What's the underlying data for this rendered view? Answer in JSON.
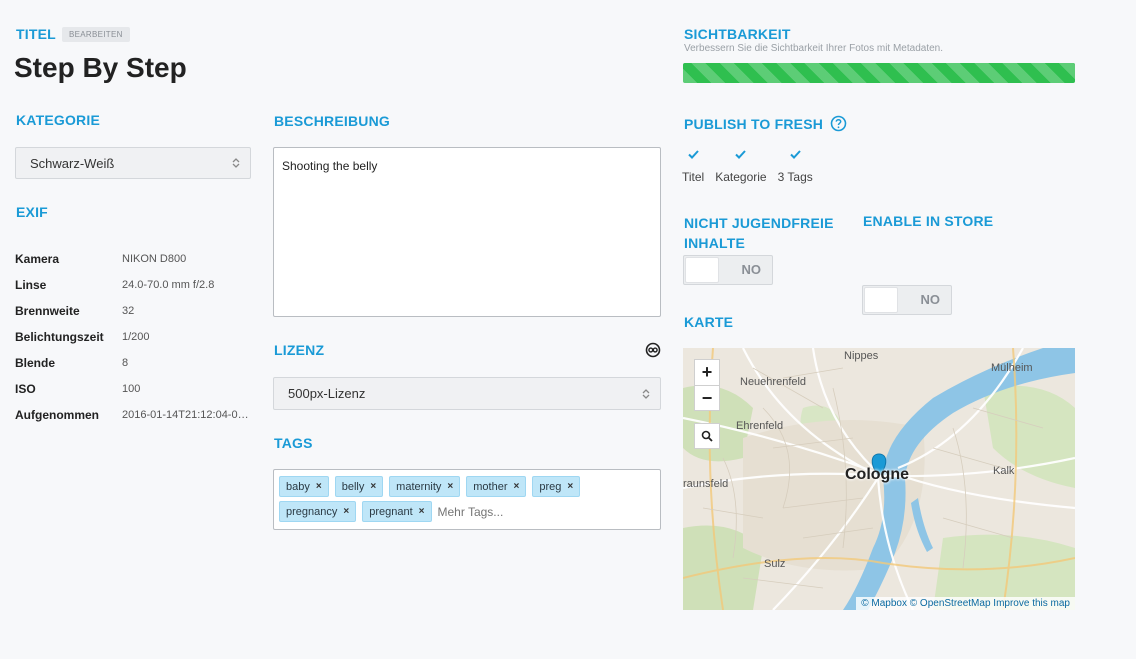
{
  "title": {
    "section_label": "TITEL",
    "edit_badge": "BEARBEITEN",
    "value": "Step By Step"
  },
  "category": {
    "section_label": "KATEGORIE",
    "selected": "Schwarz-Weiß"
  },
  "exif": {
    "section_label": "EXIF",
    "rows": [
      {
        "label": "Kamera",
        "value": "NIKON D800"
      },
      {
        "label": "Linse",
        "value": "24.0-70.0 mm f/2.8"
      },
      {
        "label": "Brennweite",
        "value": "32"
      },
      {
        "label": "Belichtungszeit",
        "value": "1/200"
      },
      {
        "label": "Blende",
        "value": "8"
      },
      {
        "label": "ISO",
        "value": "100"
      },
      {
        "label": "Aufgenommen",
        "value": "2016-01-14T21:12:04-0…"
      }
    ]
  },
  "description": {
    "section_label": "BESCHREIBUNG",
    "value": "Shooting the belly"
  },
  "license": {
    "section_label": "LIZENZ",
    "icon": "creative-commons-icon",
    "selected": "500px-Lizenz"
  },
  "tags": {
    "section_label": "TAGS",
    "items": [
      "baby",
      "belly",
      "maternity",
      "mother",
      "preg",
      "pregnancy",
      "pregnant"
    ],
    "remove_glyph": "×",
    "placeholder": "Mehr Tags..."
  },
  "visibility": {
    "section_label": "SICHTBARKEIT",
    "subtitle": "Verbessern Sie die Sichtbarkeit Ihrer Fotos mit Metadaten.",
    "progress": 1.0,
    "color": "#2fbf4f"
  },
  "publish": {
    "section_label": "PUBLISH TO FRESH",
    "help_icon": "help-circle-icon",
    "checks": [
      "Titel",
      "Kategorie",
      "3 Tags"
    ]
  },
  "adult": {
    "section_label_1": "NICHT JUGENDFREIE",
    "section_label_2": "INHALTE",
    "state": "NO"
  },
  "store": {
    "section_label": "ENABLE IN STORE",
    "state": "NO"
  },
  "map": {
    "section_label": "KARTE",
    "zoom_in": "+",
    "zoom_out": "−",
    "labels": {
      "nippes": "Nippes",
      "neuehrenfeld": "Neuehrenfeld",
      "muelheim": "Mülheim",
      "ehrenfeld": "Ehrenfeld",
      "kalk": "Kalk",
      "braunsfeld": "raunsfeld",
      "cologne": "Cologne",
      "sulz": "Sulz"
    },
    "attribution": {
      "mapbox": "© Mapbox",
      "osm": "© OpenStreetMap",
      "improve": "Improve this map"
    }
  },
  "colors": {
    "accent": "#1a9ad6",
    "tag_bg": "#bfe6f8",
    "river": "#8ec5e6"
  }
}
